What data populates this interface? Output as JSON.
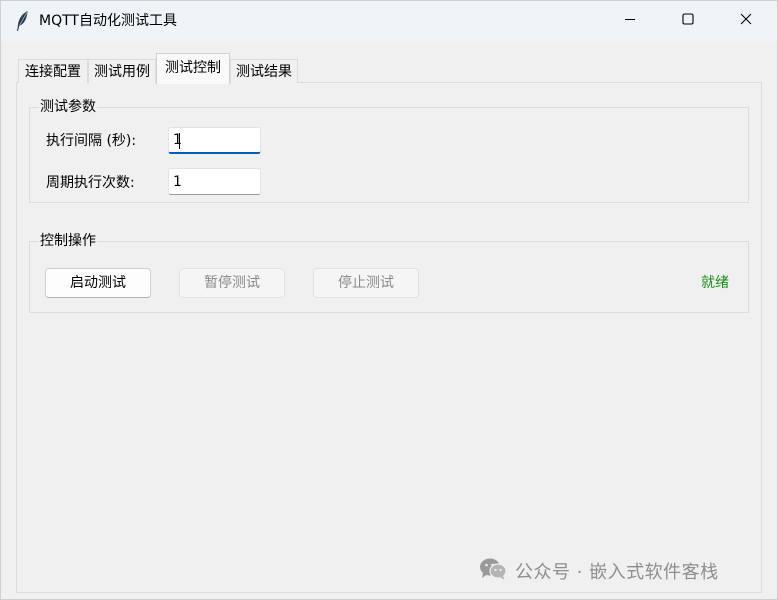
{
  "window": {
    "title": "MQTT自动化测试工具",
    "icon": "feather-icon",
    "controls": [
      "minimize-icon",
      "maximize-icon",
      "close-icon"
    ]
  },
  "tabs": [
    {
      "label": "连接配置",
      "active": false
    },
    {
      "label": "测试用例",
      "active": false
    },
    {
      "label": "测试控制",
      "active": true
    },
    {
      "label": "测试结果",
      "active": false
    }
  ],
  "params_group": {
    "title": "测试参数",
    "interval": {
      "label": "执行间隔 (秒):",
      "value": "1"
    },
    "cycles": {
      "label": "周期执行次数:",
      "value": "1"
    }
  },
  "control_group": {
    "title": "控制操作",
    "start_label": "启动测试",
    "pause_label": "暂停测试",
    "stop_label": "停止测试",
    "status": "就绪",
    "status_color": "#1a8a1a"
  },
  "watermark": {
    "icon": "wechat-icon",
    "text": "公众号 · 嵌入式软件客栈"
  },
  "colors": {
    "accent": "#005fb8",
    "window_bg": "#f0f0f0",
    "titlebar_bg": "#eff4f9"
  }
}
